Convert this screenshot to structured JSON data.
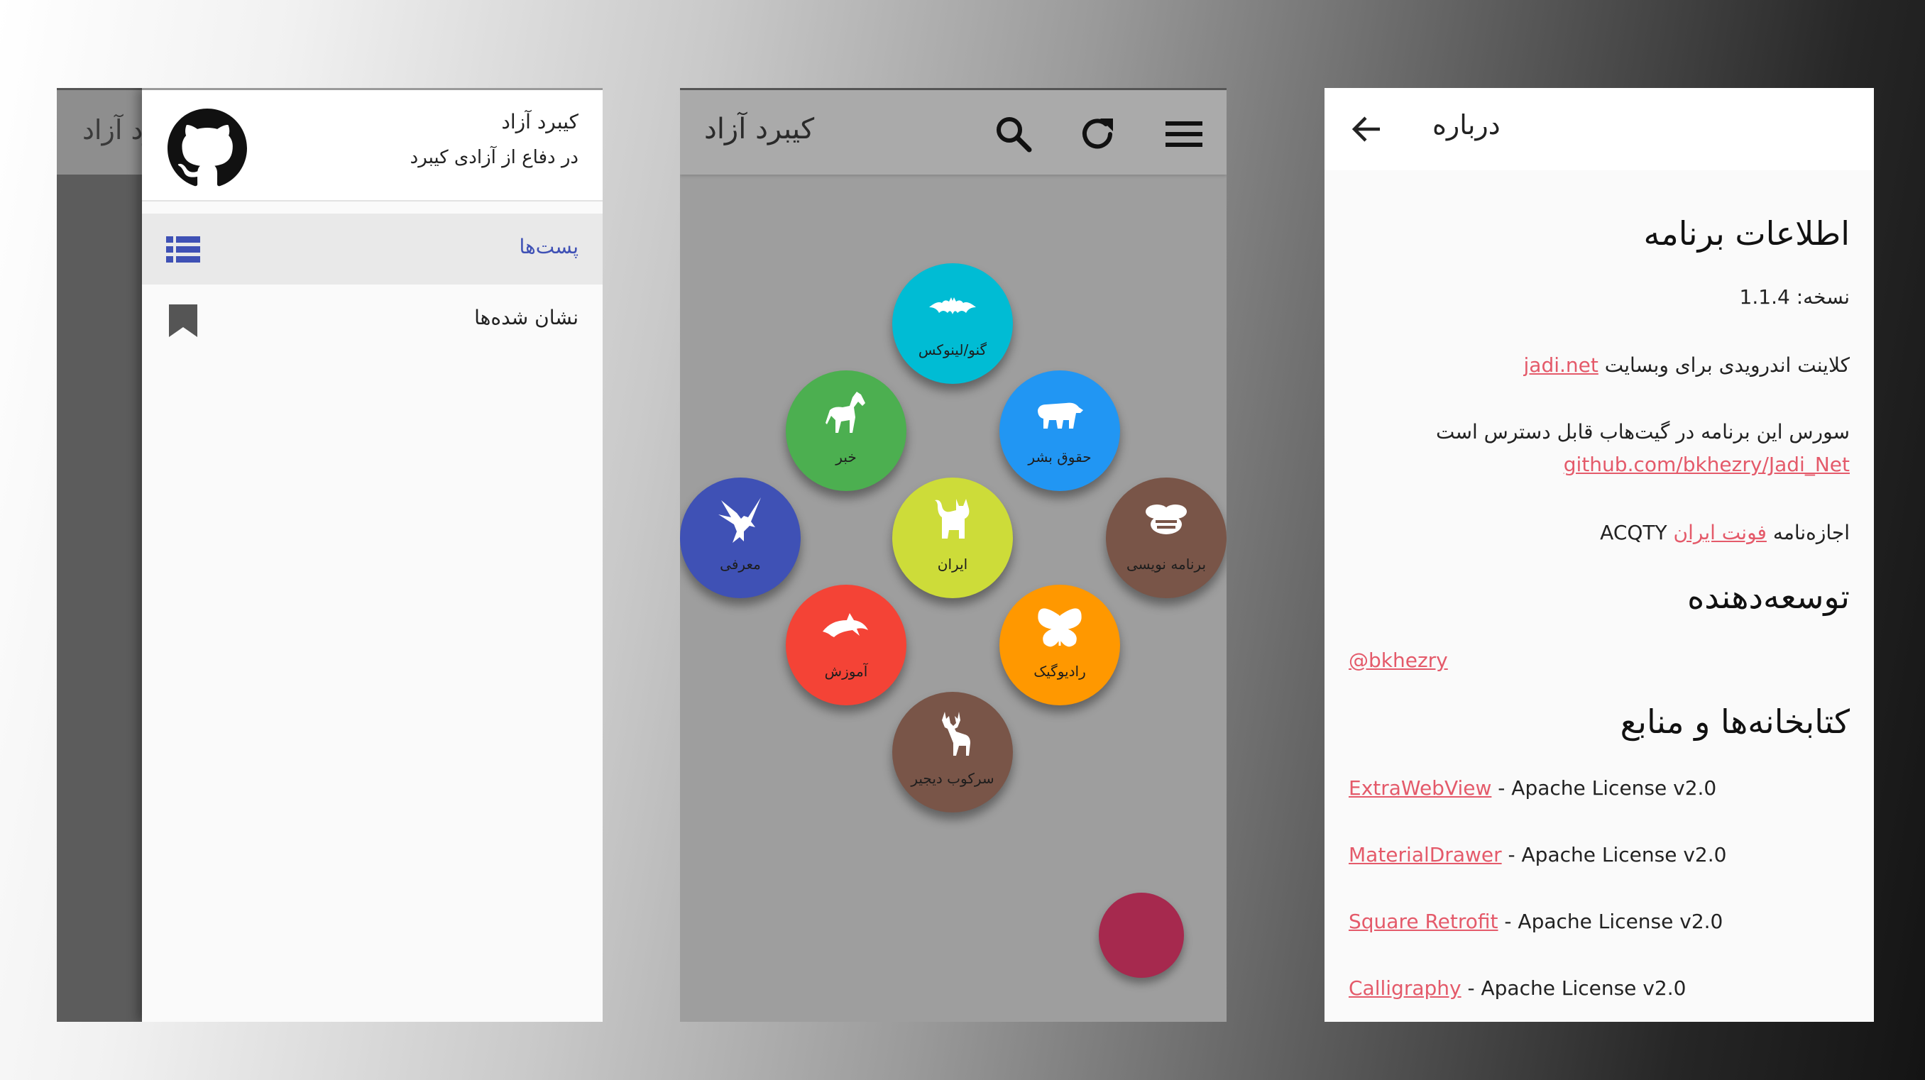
{
  "drawer_screen": {
    "behind_title": "کیبرد آزاد",
    "header": {
      "app_name": "کیبرد آزاد",
      "tagline": "در دفاع از آزادی کیبرد",
      "logo_icon": "github-icon"
    },
    "items": [
      {
        "label": "پست‌ها",
        "icon": "list-icon",
        "active": true
      },
      {
        "label": "نشان شده‌ها",
        "icon": "bookmark-icon",
        "active": false
      }
    ]
  },
  "main_screen": {
    "title": "کیبرد آزاد",
    "toolbar_icons": [
      "search-icon",
      "refresh-icon",
      "menu-icon"
    ],
    "categories": [
      {
        "label": "گنو/لینوکس",
        "icon": "bat-icon",
        "color": "#00bcd4"
      },
      {
        "label": "خبر",
        "icon": "horse-icon",
        "color": "#4caf50"
      },
      {
        "label": "حقوق بشر",
        "icon": "bear-icon",
        "color": "#2196f3"
      },
      {
        "label": "معرفی",
        "icon": "eagle-icon",
        "color": "#3f51b5"
      },
      {
        "label": "ایران",
        "icon": "cat-icon",
        "color": "#cddc39"
      },
      {
        "label": "برنامه نویسی",
        "icon": "bee-icon",
        "color": "#795548"
      },
      {
        "label": "آموزش",
        "icon": "dolphin-icon",
        "color": "#f44336"
      },
      {
        "label": "رادیوگیک",
        "icon": "butterfly-icon",
        "color": "#ff9800"
      },
      {
        "label": "سرکوب دیجیر",
        "icon": "deer-icon",
        "color": "#795548"
      }
    ],
    "fab_color": "#a6294e"
  },
  "about_screen": {
    "title": "درباره",
    "app_info_heading": "اطلاعات برنامه",
    "version_label": "نسخه:",
    "version": "1.1.4",
    "client_text": "کلاینت اندرویدی برای وبسایت",
    "client_link": "jadi.net",
    "source_text": "سورس این برنامه در گیت‌هاب قابل دسترس است",
    "source_link": "github.com/bkhezry/Jadi_Net",
    "license_text": "اجازه‌نامه",
    "license_link": "فونت ایران",
    "license_suffix": "ACQTY",
    "developer_heading": "توسعه‌دهنده",
    "developer_link": "@bkhezry",
    "libraries_heading": "کتابخانه‌ها و منابع",
    "libraries": [
      {
        "name": "ExtraWebView",
        "license": " - Apache License v2.0"
      },
      {
        "name": "MaterialDrawer",
        "license": " - Apache License v2.0"
      },
      {
        "name": "Square Retrofit",
        "license": " - Apache License v2.0"
      },
      {
        "name": "Calligraphy",
        "license": " - Apache License v2.0"
      }
    ]
  }
}
